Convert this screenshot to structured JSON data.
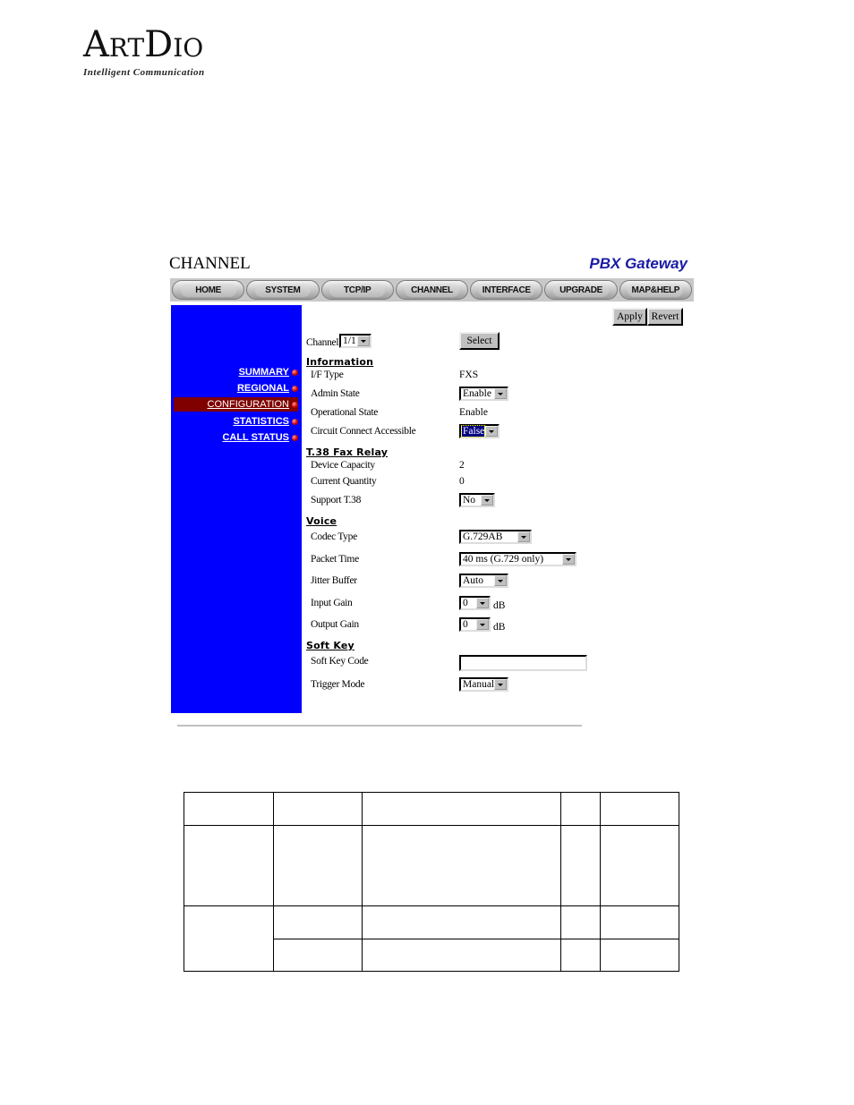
{
  "logo": {
    "name_part1": "A",
    "name_part2": "RT",
    "name_part3": "D",
    "name_part4": "IO",
    "tagline": "Intelligent Communication"
  },
  "header": {
    "page_title": "CHANNEL",
    "brand_title": "PBX Gateway"
  },
  "nav": {
    "items": [
      "HOME",
      "SYSTEM",
      "TCP/IP",
      "CHANNEL",
      "INTERFACE",
      "UPGRADE",
      "MAP&HELP"
    ]
  },
  "sidebar": {
    "items": [
      {
        "label": "SUMMARY",
        "active": false
      },
      {
        "label": "REGIONAL",
        "active": false
      },
      {
        "label": "CONFIGURATION",
        "active": true
      },
      {
        "label": "STATISTICS",
        "active": false
      },
      {
        "label": "CALL STATUS",
        "active": false
      }
    ],
    "colors": {
      "background": "#0000ff",
      "active": "#800000"
    }
  },
  "toolbar": {
    "apply_label": "Apply",
    "revert_label": "Revert",
    "select_label": "Select"
  },
  "channel": {
    "label": "Channel",
    "value": "1/1"
  },
  "sections": {
    "information": {
      "title": "Information",
      "if_type_label": "I/F Type",
      "if_type_value": "FXS",
      "admin_state_label": "Admin State",
      "admin_state_value": "Enable",
      "operational_state_label": "Operational State",
      "operational_state_value": "Enable",
      "circuit_connect_label": "Circuit Connect Accessible",
      "circuit_connect_value": "False"
    },
    "fax": {
      "title": "T.38 Fax Relay",
      "device_capacity_label": "Device Capacity",
      "device_capacity_value": "2",
      "current_quantity_label": "Current Quantity",
      "current_quantity_value": "0",
      "support_t38_label": "Support T.38",
      "support_t38_value": "No"
    },
    "voice": {
      "title": "Voice",
      "codec_label": "Codec Type",
      "codec_value": "G.729AB",
      "packet_time_label": "Packet Time",
      "packet_time_value": "40 ms (G.729 only)",
      "jitter_label": "Jitter Buffer",
      "jitter_value": "Auto",
      "input_gain_label": "Input Gain",
      "input_gain_value": "0",
      "output_gain_label": "Output Gain",
      "output_gain_value": "0",
      "gain_unit": "dB"
    },
    "softkey": {
      "title": "Soft Key",
      "code_label": "Soft Key Code",
      "code_value": "",
      "trigger_label": "Trigger Mode",
      "trigger_value": "Manual"
    }
  },
  "doc_table": {
    "rows": [
      [
        "",
        "",
        "",
        "",
        ""
      ],
      [
        "",
        "",
        "",
        "",
        ""
      ],
      [
        "",
        "",
        "",
        ""
      ],
      [
        "",
        "",
        "",
        ""
      ]
    ]
  }
}
